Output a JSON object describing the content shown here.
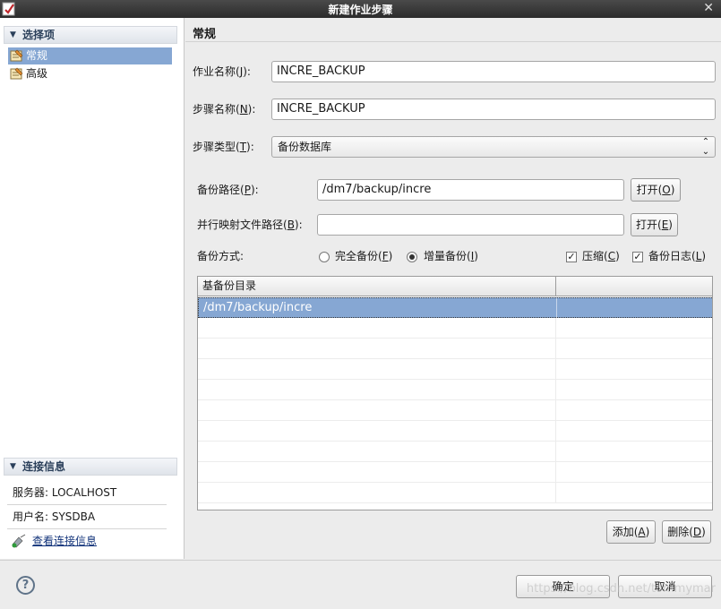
{
  "window": {
    "title": "新建作业步骤",
    "close_glyph": "✕"
  },
  "sidebar": {
    "options_header": "选择项",
    "items": [
      {
        "label": "常规",
        "selected": true
      },
      {
        "label": "高级",
        "selected": false
      }
    ],
    "connection_header": "连接信息",
    "server": "服务器: LOCALHOST",
    "user": "用户名: SYSDBA",
    "view_link": "查看连接信息"
  },
  "main": {
    "title": "常规",
    "job_name": {
      "label": "作业名称(",
      "key": "J",
      "suffix": "):",
      "value": "INCRE_BACKUP"
    },
    "step_name": {
      "label": "步骤名称(",
      "key": "N",
      "suffix": "):",
      "value": "INCRE_BACKUP"
    },
    "step_type": {
      "label": "步骤类型(",
      "key": "T",
      "suffix": "):",
      "value": "备份数据库"
    },
    "backup_path": {
      "label": "备份路径(",
      "key": "P",
      "suffix": "):",
      "value": "/dm7/backup/incre",
      "button_label": "打开(",
      "button_key": "O",
      "button_suffix": ")"
    },
    "mapfile_path": {
      "label": "并行映射文件路径(",
      "key": "B",
      "suffix": "):",
      "value": "",
      "button_label": "打开(",
      "button_key": "E",
      "button_suffix": ")"
    },
    "backup_mode": {
      "label": "备份方式:",
      "full": {
        "label": "完全备份(",
        "key": "F",
        "suffix": ")",
        "selected": false
      },
      "incremental": {
        "label": "增量备份(",
        "key": "I",
        "suffix": ")",
        "selected": true
      },
      "compress": {
        "label": "压缩(",
        "key": "C",
        "suffix": ")",
        "checked": true
      },
      "backup_log": {
        "label": "备份日志(",
        "key": "L",
        "suffix": ")",
        "checked": true
      }
    },
    "base_table": {
      "columns": [
        "基备份目录",
        ""
      ],
      "rows": [
        [
          "/dm7/backup/incre",
          ""
        ]
      ]
    },
    "add_button": {
      "label": "添加(",
      "key": "A",
      "suffix": ")"
    },
    "delete_button": {
      "label": "删除(",
      "key": "D",
      "suffix": ")"
    }
  },
  "footer": {
    "help_glyph": "?",
    "ok_label": "确定",
    "cancel_label": "取消",
    "watermark": "https://blog.csdn.net/tommymar"
  }
}
